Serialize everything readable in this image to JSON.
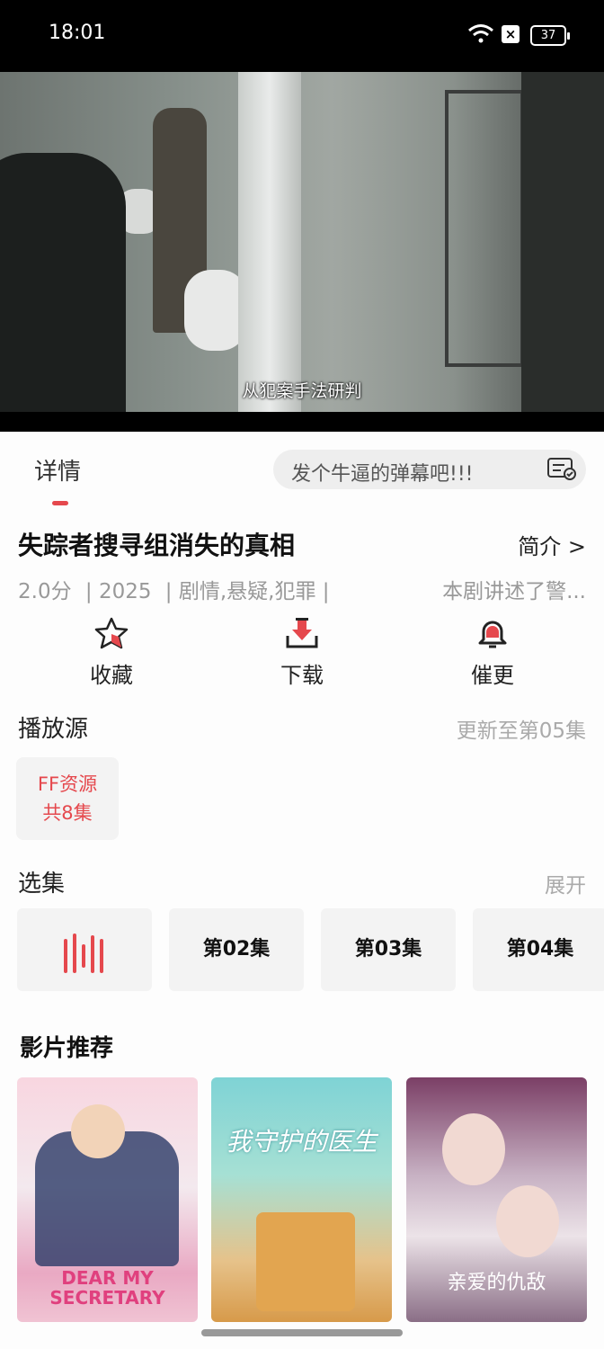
{
  "status_bar": {
    "time": "18:01",
    "battery": "37"
  },
  "video": {
    "subtitle": "从犯案手法研判"
  },
  "tabs": {
    "detail": "详情"
  },
  "danmu": {
    "placeholder": "发个牛逼的弹幕吧!!!"
  },
  "show": {
    "title": "失踪者搜寻组消失的真相",
    "intro_link": "简介 >",
    "score": "2.0分",
    "year": "| 2025",
    "genres": "| 剧情,悬疑,犯罪 |",
    "description": "本剧讲述了警..."
  },
  "actions": [
    {
      "label": "收藏",
      "icon": "star-icon"
    },
    {
      "label": "下载",
      "icon": "download-icon"
    },
    {
      "label": "催更",
      "icon": "bell-icon"
    }
  ],
  "source": {
    "title": "播放源",
    "update": "更新至第05集",
    "name": "FF资源",
    "count": "共8集"
  },
  "episodes": {
    "title": "选集",
    "expand": "展开",
    "items": [
      "playing",
      "第02集",
      "第03集",
      "第04集"
    ]
  },
  "recommend": {
    "title": "影片推荐",
    "posters": [
      {
        "title": "DEAR MY SECRETARY"
      },
      {
        "title": "我守护的医生"
      },
      {
        "title": "亲爱的仇敌"
      }
    ]
  },
  "colors": {
    "accent": "#e5484d"
  }
}
